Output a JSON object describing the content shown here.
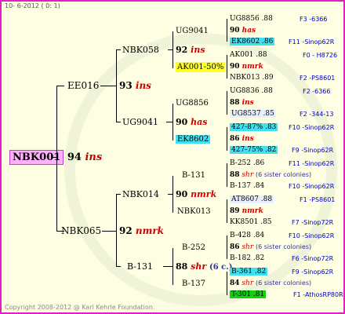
{
  "header": "10- 6-2012 ( 0: 1)",
  "footer": "Copyright 2008-2012 @ Karl Kehrle Foundation.",
  "root": {
    "id": "NBK001",
    "year": "94",
    "breed": "ins"
  },
  "gen1": [
    {
      "id": "EE016"
    },
    {
      "id": "NBK065"
    }
  ],
  "gen1b": [
    {
      "year": "93",
      "breed": "ins"
    },
    {
      "year": "92",
      "breed": "nmrk"
    }
  ],
  "gen2": [
    {
      "id": "NBK058",
      "year": "92",
      "breed": "ins"
    },
    {
      "id": "UG9041",
      "year": "90",
      "breed": "has"
    },
    {
      "id": "NBK014",
      "year": "90",
      "breed": "nmrk"
    },
    {
      "id": "B-131",
      "year": "88",
      "breed": "shr",
      "siblings": "(6 c.)"
    }
  ],
  "gen3": [
    {
      "id": "UG9041",
      "year": "92",
      "breed": "ins"
    },
    {
      "id": "AK001-50%"
    },
    {
      "id": "UG8856",
      "year": "90",
      "breed": "has"
    },
    {
      "id": "EK8602"
    },
    {
      "id": "B-131",
      "year": "90",
      "breed": "nmrk"
    },
    {
      "id": "NBK013"
    },
    {
      "id": "B-252",
      "year": "88",
      "breed": "shr"
    },
    {
      "id": "B-137"
    }
  ],
  "gen4": [
    {
      "id": "UG8856 .88",
      "origin": "F3 -6366"
    },
    {
      "id": "90",
      "breed": "has"
    },
    {
      "id": "EK8602 .86",
      "origin": "F11 -Sinop62R"
    },
    {
      "id": "AK001 .88",
      "origin": "F0 - H8726"
    },
    {
      "id": "90",
      "breed": "nmrk"
    },
    {
      "id": "NBK013 .89",
      "origin": "F2 -PS8601"
    },
    {
      "id": "UG8836 .88",
      "origin": "F2 -6366"
    },
    {
      "id": "88",
      "breed": "ins"
    },
    {
      "id": "UG8537 .85",
      "origin": "F2 -344-13"
    },
    {
      "id": "427-87% .83",
      "origin": "F10 -Sinop62R"
    },
    {
      "id": "86",
      "breed": "ins"
    },
    {
      "id": "427-75% .82",
      "origin": "F9 -Sinop62R"
    },
    {
      "id": "B-252 .86",
      "origin": "F11 -Sinop62R"
    },
    {
      "id": "88",
      "breed": "shr",
      "siblings": "(6 sister colonies)"
    },
    {
      "id": "B-137 .84",
      "origin": "F10 -Sinop62R"
    },
    {
      "id": "AT8607 .88",
      "origin": "F1 -PS8601"
    },
    {
      "id": "89",
      "breed": "nmrk"
    },
    {
      "id": "KK8501 .85",
      "origin": "F7 -Sinop72R"
    },
    {
      "id": "B-428 .84",
      "origin": "F10 -Sinop62R"
    },
    {
      "id": "86",
      "breed": "shr",
      "siblings": "(6 sister colonies)"
    },
    {
      "id": "B-182 .82",
      "origin": "F6 -Sinop72R"
    },
    {
      "id": "B-361 .82",
      "origin": "F9 -Sinop62R"
    },
    {
      "id": "84",
      "breed": "shr",
      "siblings": "(6 sister colonies)"
    },
    {
      "id": "T-301 .81",
      "origin": "F1 -AthosRP80R"
    }
  ]
}
